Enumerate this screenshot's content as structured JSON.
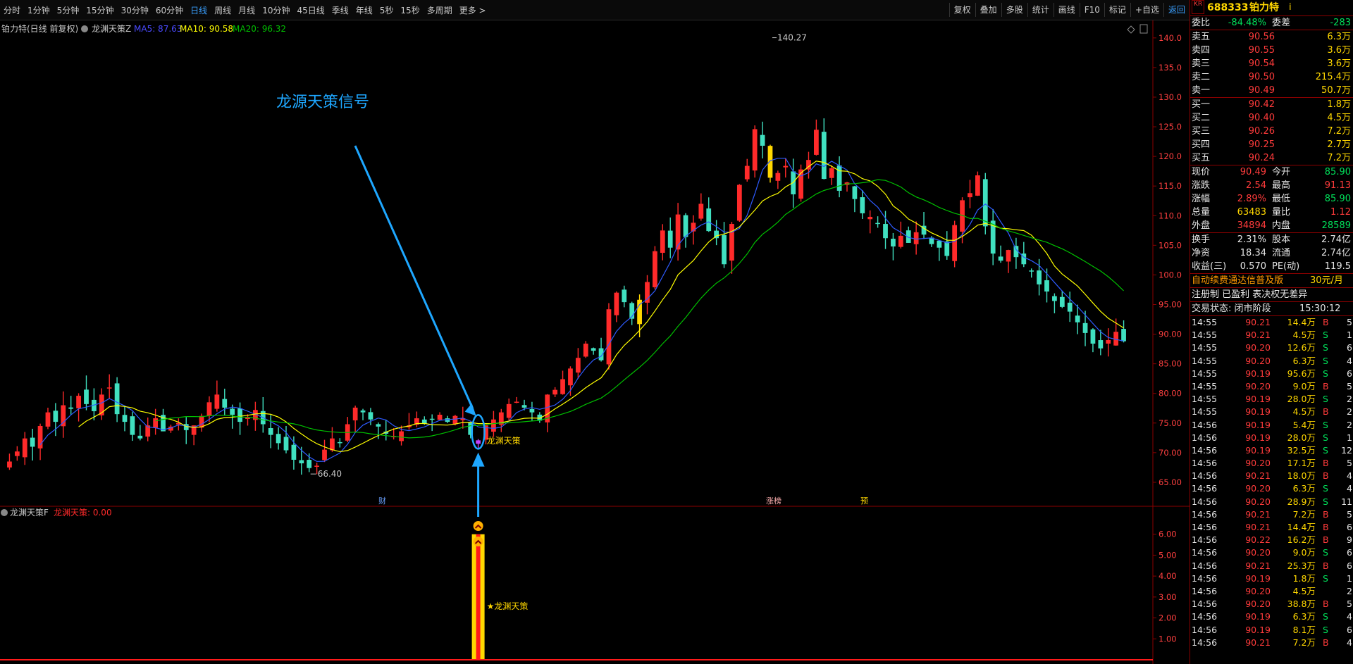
{
  "toolbar": {
    "periods": [
      "分时",
      "1分钟",
      "5分钟",
      "15分钟",
      "30分钟",
      "60分钟",
      "日线",
      "周线",
      "月线",
      "10分钟",
      "45日线",
      "季线",
      "年线",
      "5秒",
      "15秒",
      "多周期",
      "更多 >"
    ],
    "active_period": "日线",
    "right_buttons": [
      "复权",
      "叠加",
      "多股",
      "统计",
      "画线",
      "F10",
      "标记",
      "+自选",
      "返回"
    ]
  },
  "chart_header": {
    "stock": "铂力特(日线 前复权)",
    "indicator": "龙渊天策Z",
    "ma5": "MA5: 87.63",
    "ma10": "MA10: 90.58",
    "ma20": "MA20: 96.32"
  },
  "annotation": {
    "signal_title": "龙源天策信号"
  },
  "price_labels": {
    "high": "140.27",
    "low": "66.40",
    "signal": "龙渊天策"
  },
  "markers": [
    "财",
    "涨榜",
    "预"
  ],
  "sub_header": {
    "name": "龙渊天策F",
    "value": "龙渊天策: 0.00"
  },
  "sub_signal_label": "★龙渊天策",
  "colors": {
    "up": "#ff2a2a",
    "down": "#40e0c0",
    "limit": "#ffd700",
    "ma5": "#ffffff",
    "ma10": "#ffff00",
    "ma20": "#00c000",
    "axis": "#8b0000",
    "annotation": "#1ea7ff"
  },
  "chart_data": [
    {
      "type": "candlestick",
      "title": "铂力特(日线 前复权)",
      "ylim": [
        60,
        142
      ],
      "yticks": [
        "140.0",
        "135.0",
        "130.0",
        "125.0",
        "120.0",
        "115.0",
        "110.0",
        "105.0",
        "100.0",
        "95.00",
        "90.00",
        "85.00",
        "80.00",
        "75.00",
        "70.00",
        "65.00"
      ],
      "close_start": 68.5,
      "closes": [
        68.5,
        70.2,
        72.4,
        71.0,
        74.5,
        76.8,
        75.2,
        78.0,
        77.4,
        79.6,
        78.2,
        77.0,
        79.8,
        81.0,
        76.5,
        75.2,
        73.0,
        72.4,
        74.6,
        75.8,
        73.6,
        74.4,
        75.0,
        73.8,
        74.6,
        76.2,
        78.5,
        79.8,
        77.6,
        76.4,
        75.2,
        76.0,
        77.2,
        74.8,
        73.0,
        71.6,
        70.4,
        68.8,
        68.2,
        67.4,
        67.8,
        70.5,
        72.4,
        71.6,
        74.8,
        77.6,
        76.8,
        75.6,
        74.4,
        73.2,
        72.8,
        73.6,
        74.6,
        75.8,
        74.9,
        75.6,
        76.4,
        75.2,
        76.2,
        75.8,
        73.0,
        71.5,
        74.6,
        75.6,
        76.8,
        78.2,
        78.6,
        77.6,
        76.8,
        75.4,
        79.8,
        80.6,
        82.4,
        84.2,
        86.0,
        88.4,
        87.2,
        85.6,
        94.2,
        97.0,
        95.4,
        92.6,
        95.8,
        98.8,
        104.0,
        107.5,
        104.6,
        110.2,
        106.4,
        108.8,
        112.0,
        107.4,
        106.2,
        101.8,
        108.6,
        115.2,
        118.4,
        124.6,
        121.8,
        116.4,
        117.2,
        118.4,
        113.6,
        117.8,
        119.4,
        124.5,
        116.2,
        118.0,
        114.2,
        115.6,
        112.8,
        110.4,
        109.8,
        108.6,
        106.2,
        104.8,
        106.6,
        105.4,
        107.2,
        106.8,
        105.2,
        104.6,
        103.2,
        108.4,
        112.6,
        113.8,
        116.8,
        108.2,
        103.6,
        102.4,
        104.2,
        103.0,
        101.8,
        100.6,
        98.4,
        97.2,
        95.6,
        94.6,
        93.8,
        92.0,
        90.2,
        88.4,
        87.6,
        89.0,
        90.4,
        88.8
      ],
      "ma_labels": [
        "MA5",
        "MA10",
        "MA20"
      ]
    },
    {
      "type": "bar",
      "title": "龙渊天策F",
      "ylim": [
        0,
        7
      ],
      "yticks": [
        "6.00",
        "5.00",
        "4.00",
        "3.00",
        "2.00",
        "1.00"
      ],
      "signal_value": 6.0
    }
  ],
  "panel": {
    "logo": "KR",
    "code": "688333",
    "name": "铂力特",
    "weibi_label": "委比",
    "weibi_value": "-84.48%",
    "weicha_label": "委差",
    "weicha_value": "-283",
    "asks": [
      {
        "label": "卖五",
        "price": "90.56",
        "vol": "6.3万"
      },
      {
        "label": "卖四",
        "price": "90.55",
        "vol": "3.6万"
      },
      {
        "label": "卖三",
        "price": "90.54",
        "vol": "3.6万"
      },
      {
        "label": "卖二",
        "price": "90.50",
        "vol": "215.4万"
      },
      {
        "label": "卖一",
        "price": "90.49",
        "vol": "50.7万"
      }
    ],
    "bids": [
      {
        "label": "买一",
        "price": "90.42",
        "vol": "1.8万"
      },
      {
        "label": "买二",
        "price": "90.40",
        "vol": "4.5万"
      },
      {
        "label": "买三",
        "price": "90.26",
        "vol": "7.2万"
      },
      {
        "label": "买四",
        "price": "90.25",
        "vol": "2.7万"
      },
      {
        "label": "买五",
        "price": "90.24",
        "vol": "7.2万"
      }
    ],
    "stats": [
      {
        "l1": "现价",
        "v1": "90.49",
        "l2": "今开",
        "v2": "85.90"
      },
      {
        "l1": "涨跌",
        "v1": "2.54",
        "l2": "最高",
        "v2": "91.13"
      },
      {
        "l1": "涨幅",
        "v1": "2.89%",
        "l2": "最低",
        "v2": "85.90"
      },
      {
        "l1": "总量",
        "v1": "63483",
        "l2": "量比",
        "v2": "1.12"
      },
      {
        "l1": "外盘",
        "v1": "34894",
        "l2": "内盘",
        "v2": "28589"
      }
    ],
    "stats2": [
      {
        "l1": "换手",
        "v1": "2.31%",
        "l2": "股本",
        "v2": "2.74亿"
      },
      {
        "l1": "净资",
        "v1": "18.34",
        "l2": "流通",
        "v2": "2.74亿"
      },
      {
        "l1": "收益(三)",
        "v1": "0.570",
        "l2": "PE(动)",
        "v2": "119.5"
      }
    ],
    "promo": "自动续费通达信普及版",
    "promo_price": "30元/月",
    "notice": "注册制 已盈利 表决权无差异",
    "trade_status": "交易状态: 闭市阶段",
    "trade_time": "15:30:12",
    "ticks": [
      {
        "t": "14:55",
        "p": "90.21",
        "v": "14.4万",
        "d": "B",
        "n": "5"
      },
      {
        "t": "14:55",
        "p": "90.21",
        "v": "4.5万",
        "d": "S",
        "n": "1"
      },
      {
        "t": "14:55",
        "p": "90.20",
        "v": "12.6万",
        "d": "S",
        "n": "6"
      },
      {
        "t": "14:55",
        "p": "90.20",
        "v": "6.3万",
        "d": "S",
        "n": "4"
      },
      {
        "t": "14:55",
        "p": "90.19",
        "v": "95.6万",
        "d": "S",
        "n": "6"
      },
      {
        "t": "14:55",
        "p": "90.20",
        "v": "9.0万",
        "d": "B",
        "n": "5"
      },
      {
        "t": "14:55",
        "p": "90.19",
        "v": "28.0万",
        "d": "S",
        "n": "2"
      },
      {
        "t": "14:55",
        "p": "90.19",
        "v": "4.5万",
        "d": "B",
        "n": "2"
      },
      {
        "t": "14:56",
        "p": "90.19",
        "v": "5.4万",
        "d": "S",
        "n": "2"
      },
      {
        "t": "14:56",
        "p": "90.19",
        "v": "28.0万",
        "d": "S",
        "n": "1"
      },
      {
        "t": "14:56",
        "p": "90.19",
        "v": "32.5万",
        "d": "S",
        "n": "12"
      },
      {
        "t": "14:56",
        "p": "90.20",
        "v": "17.1万",
        "d": "B",
        "n": "5"
      },
      {
        "t": "14:56",
        "p": "90.21",
        "v": "18.0万",
        "d": "B",
        "n": "4"
      },
      {
        "t": "14:56",
        "p": "90.20",
        "v": "6.3万",
        "d": "S",
        "n": "4"
      },
      {
        "t": "14:56",
        "p": "90.20",
        "v": "28.9万",
        "d": "S",
        "n": "11"
      },
      {
        "t": "14:56",
        "p": "90.21",
        "v": "7.2万",
        "d": "B",
        "n": "5"
      },
      {
        "t": "14:56",
        "p": "90.21",
        "v": "14.4万",
        "d": "B",
        "n": "6"
      },
      {
        "t": "14:56",
        "p": "90.22",
        "v": "16.2万",
        "d": "B",
        "n": "9"
      },
      {
        "t": "14:56",
        "p": "90.20",
        "v": "9.0万",
        "d": "S",
        "n": "6"
      },
      {
        "t": "14:56",
        "p": "90.21",
        "v": "25.3万",
        "d": "B",
        "n": "6"
      },
      {
        "t": "14:56",
        "p": "90.19",
        "v": "1.8万",
        "d": "S",
        "n": "1"
      },
      {
        "t": "14:56",
        "p": "90.20",
        "v": "4.5万",
        "d": "",
        "n": "2"
      },
      {
        "t": "14:56",
        "p": "90.20",
        "v": "38.8万",
        "d": "B",
        "n": "5"
      },
      {
        "t": "14:56",
        "p": "90.19",
        "v": "6.3万",
        "d": "S",
        "n": "4"
      },
      {
        "t": "14:56",
        "p": "90.19",
        "v": "8.1万",
        "d": "S",
        "n": "6"
      },
      {
        "t": "14:56",
        "p": "90.21",
        "v": "7.2万",
        "d": "B",
        "n": "4"
      }
    ]
  }
}
